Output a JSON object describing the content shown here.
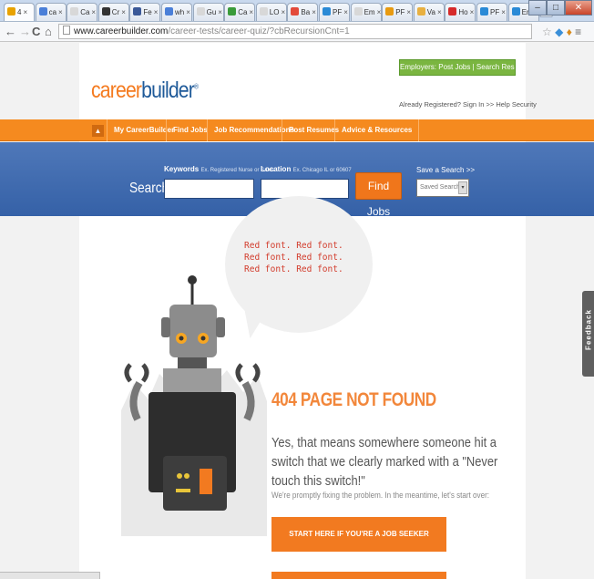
{
  "browser": {
    "tabs": [
      {
        "label": "4",
        "color": "#e8a200"
      },
      {
        "label": "ca",
        "color": "#4a7fd8"
      },
      {
        "label": "Ca",
        "color": "#d8d8d8"
      },
      {
        "label": "Cr",
        "color": "#333333"
      },
      {
        "label": "Fe",
        "color": "#3b5998"
      },
      {
        "label": "wh",
        "color": "#4a7fd8"
      },
      {
        "label": "Gu",
        "color": "#d8d8d8"
      },
      {
        "label": "Ca",
        "color": "#3a9b3a"
      },
      {
        "label": "LO",
        "color": "#d8d8d8"
      },
      {
        "label": "Ba",
        "color": "#e34a3a"
      },
      {
        "label": "PF",
        "color": "#2a8ad6"
      },
      {
        "label": "Em",
        "color": "#d8d8d8"
      },
      {
        "label": "PF",
        "color": "#e89a10"
      },
      {
        "label": "Va",
        "color": "#e8b040"
      },
      {
        "label": "Ho",
        "color": "#d62a2a"
      },
      {
        "label": "PF",
        "color": "#2a8ad6"
      },
      {
        "label": "Em",
        "color": "#2a8ad6"
      }
    ],
    "url_host": "www.careerbuilder.com",
    "url_path": "/career-tests/career-quiz/?cbRecursionCnt=1"
  },
  "header": {
    "logo_part1": "career",
    "logo_part2": "builder",
    "logo_mark": "®",
    "employers_button": "Employers: Post Jobs | Search Resumes",
    "signin_links": "Already Registered? Sign In >>   Help   Security"
  },
  "nav": {
    "home_icon": "home-icon",
    "items": [
      "My CareerBuilder",
      "Find Jobs",
      "Job Recommendations",
      "Post Resumes",
      "Advice & Resources"
    ]
  },
  "search": {
    "title": "Search",
    "keywords_label": "Keywords",
    "keywords_example": "Ex. Registered Nurse or Sales",
    "location_label": "Location",
    "location_example": "Ex. Chicago IL or 60607",
    "find_button": "Find Jobs",
    "save_label": "Save a Search >>",
    "saved_select": "Saved Searches"
  },
  "error_page": {
    "bubble_lines": [
      "Red font. Red font.",
      "Red font. Red font.",
      "Red font. Red font."
    ],
    "heading": "404 PAGE NOT FOUND",
    "message": "Yes, that means somewhere someone hit a switch that we clearly marked with a \"Never touch this switch!\"",
    "sub_message": "We're promptly fixing the problem. In the meantime, let's start over:",
    "cta_label": "START HERE IF YOU'RE A JOB SEEKER"
  },
  "feedback": {
    "label": "Feedback"
  },
  "colors": {
    "orange": "#f58a1f",
    "blue": "#3561a7",
    "green": "#7ab540",
    "red_text": "#d23b2b"
  }
}
